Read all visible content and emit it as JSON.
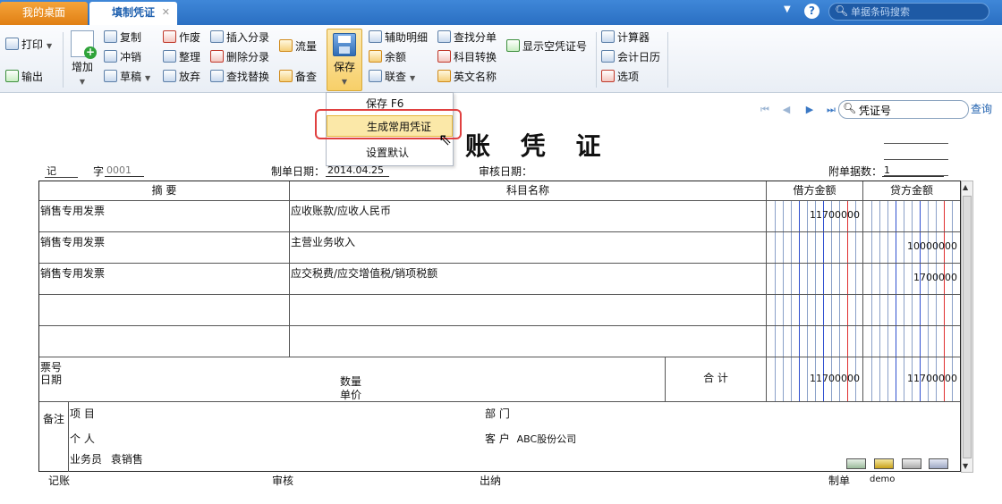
{
  "tabs": {
    "desktop": "我的桌面",
    "voucher": "填制凭证",
    "close": "✕"
  },
  "search": {
    "placeholder": "单据条码搜索"
  },
  "ribbon": {
    "print": "打印",
    "output": "输出",
    "add": "增加",
    "copy": "复制",
    "reverse": "冲销",
    "draft": "草稿",
    "void": "作废",
    "tidy": "整理",
    "discard": "放弃",
    "insert_entry": "插入分录",
    "delete_entry": "删除分录",
    "find_replace": "查找替换",
    "flow": "流量",
    "reserve_check": "备查",
    "save": "保存",
    "aux_detail": "辅助明细",
    "balance": "余额",
    "linked_query": "联查",
    "find_entry": "查找分单",
    "account_convert": "科目转换",
    "english_name": "英文名称",
    "show_empty_voucher_no": "显示空凭证号",
    "calculator": "计算器",
    "accounting_calendar": "会计日历",
    "options": "选项"
  },
  "save_menu": {
    "items": [
      "保存 F6",
      "生成常用凭证",
      "设置默认"
    ]
  },
  "voucher_search": {
    "value": "凭证号",
    "query": "查询"
  },
  "voucher": {
    "title": "账 凭 证",
    "type_label": "记",
    "zi_label": "字",
    "number": "0001",
    "date_label": "制单日期：",
    "date": "2014.04.25",
    "audit_date_label": "审核日期：",
    "attachments_label": "附单据数：",
    "attachments": "1",
    "columns": {
      "summary": "摘 要",
      "account": "科目名称",
      "debit": "借方金额",
      "credit": "贷方金额"
    },
    "rows": [
      {
        "summary": "销售专用发票",
        "account": "应收账款/应收人民币",
        "debit": "11700000",
        "credit": ""
      },
      {
        "summary": "销售专用发票",
        "account": "主营业务收入",
        "debit": "",
        "credit": "10000000"
      },
      {
        "summary": "销售专用发票",
        "account": "应交税费/应交增值税/销项税额",
        "debit": "",
        "credit": "1700000"
      },
      {
        "summary": "",
        "account": "",
        "debit": "",
        "credit": ""
      },
      {
        "summary": "",
        "account": "",
        "debit": "",
        "credit": ""
      }
    ],
    "ticket_no_label": "票号",
    "date_short_label": "日期",
    "quantity_label": "数量",
    "unit_price_label": "单价",
    "total_label": "合 计",
    "total_debit": "11700000",
    "total_credit": "11700000",
    "remarks_label": "备注",
    "project_label": "项  目",
    "department_label": "部  门",
    "individual_label": "个  人",
    "customer_label": "客  户",
    "customer_value": "ABC股份公司",
    "salesperson_label": "业务员",
    "salesperson_value": "袁销售"
  },
  "footer": {
    "bookkeeping": "记账",
    "audit": "审核",
    "cashier": "出纳",
    "preparer_label": "制单",
    "preparer": "demo"
  }
}
